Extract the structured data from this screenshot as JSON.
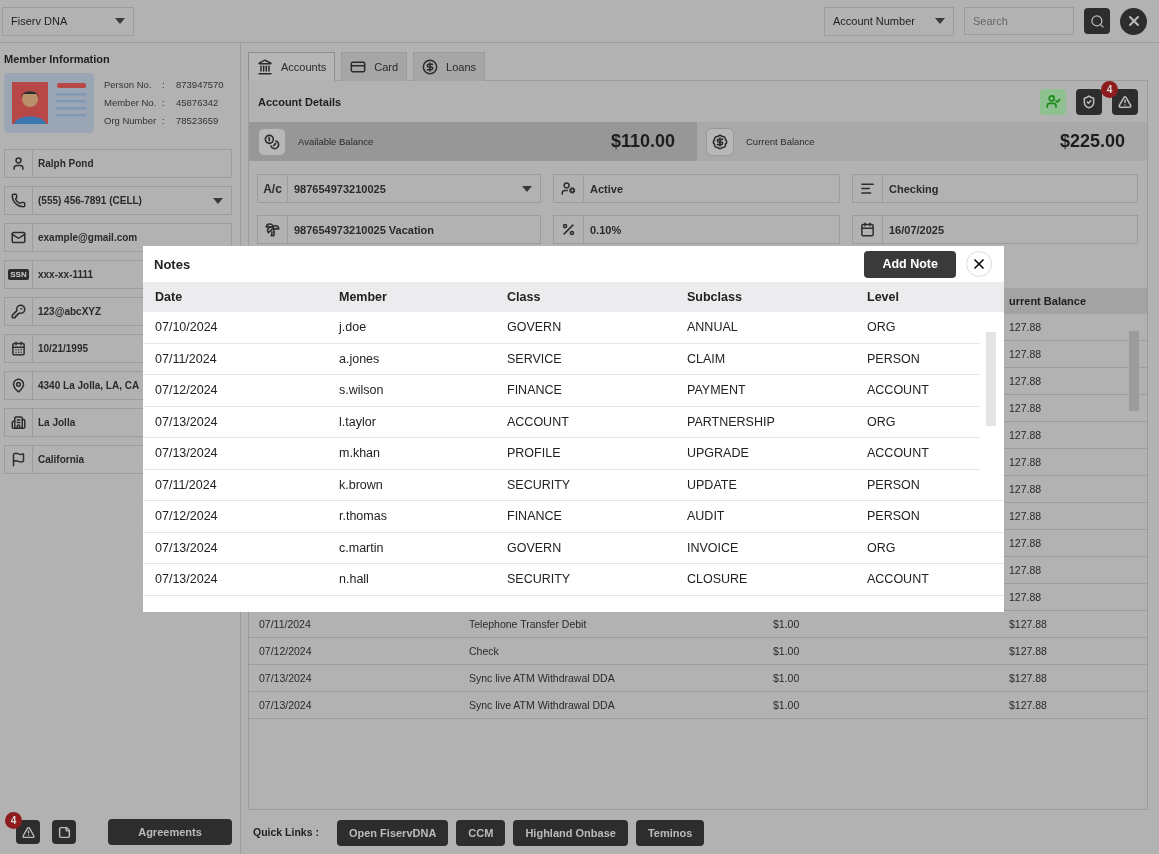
{
  "app_selector": {
    "value": "Fiserv DNA"
  },
  "search_bar": {
    "type_selector": "Account Number",
    "placeholder": "Search"
  },
  "member": {
    "title": "Member Information",
    "ids": [
      {
        "label": "Person No.",
        "sep": ":",
        "value": "873947570"
      },
      {
        "label": "Member No.",
        "sep": ":",
        "value": "45876342"
      },
      {
        "label": "Org Number",
        "sep": ":",
        "value": "78523659"
      }
    ],
    "fields": [
      {
        "value": "Ralph Pond",
        "dropdown": false
      },
      {
        "value": "(555) 456-7891 (CELL)",
        "dropdown": true
      },
      {
        "value": "example@gmail.com",
        "dropdown": false
      },
      {
        "badge": "SSN",
        "value": "xxx-xx-1111"
      },
      {
        "value": "123@abcXYZ"
      },
      {
        "value": "10/21/1995"
      },
      {
        "value": "4340 La Jolla, LA, CA"
      },
      {
        "value": "La Jolla"
      },
      {
        "value": "California"
      }
    ],
    "alerts_badge": "4",
    "agreements_button": "Agreements"
  },
  "tabs": [
    {
      "label": "Accounts",
      "selected": true
    },
    {
      "label": "Card",
      "selected": false
    },
    {
      "label": "Loans",
      "selected": false
    }
  ],
  "account_details": {
    "title": "Account Details",
    "alerts_badge": "4",
    "balances": [
      {
        "label": "Available Balance",
        "amount": "$110.00",
        "highlighted": true
      },
      {
        "label": "Current Balance",
        "amount": "$225.00",
        "highlighted": false
      }
    ],
    "fields": [
      {
        "badge": "A/c",
        "value": "987654973210025",
        "dropdown": true
      },
      {
        "value": "Active",
        "dropdown": false
      },
      {
        "value": "Checking",
        "dropdown": false
      },
      {
        "value": "987654973210025 Vacation",
        "dropdown": false
      },
      {
        "value": "0.10%",
        "dropdown": false
      },
      {
        "value": "16/07/2025",
        "dropdown": false
      }
    ],
    "transactions": {
      "column_4": "urrent Balance",
      "rows": [
        {
          "balance": "127.88"
        },
        {
          "balance": "127.88"
        },
        {
          "balance": "127.88"
        },
        {
          "balance": "127.88"
        },
        {
          "balance": "127.88"
        },
        {
          "balance": "127.88"
        },
        {
          "balance": "127.88"
        },
        {
          "balance": "127.88"
        },
        {
          "balance": "127.88"
        },
        {
          "balance": "127.88"
        },
        {
          "balance": "127.88"
        },
        {
          "date": "07/11/2024",
          "description": "Telephone Transfer Debit",
          "amount": "$1.00",
          "balance": "$127.88"
        },
        {
          "date": "07/12/2024",
          "description": "Check",
          "amount": "$1.00",
          "balance": "$127.88"
        },
        {
          "date": "07/13/2024",
          "description": "Sync live ATM Withdrawal DDA",
          "amount": "$1.00",
          "balance": "$127.88"
        },
        {
          "date": "07/13/2024",
          "description": "Sync live ATM Withdrawal DDA",
          "amount": "$1.00",
          "balance": "$127.88"
        }
      ]
    }
  },
  "quick_links": {
    "label": "Quick Links :",
    "links": [
      "Open FiservDNA",
      "CCM",
      "Highland Onbase",
      "Teminos"
    ]
  },
  "notes_dialog": {
    "title": "Notes",
    "add_button": "Add Note",
    "columns": [
      "Date",
      "Member",
      "Class",
      "Subclass",
      "Level"
    ],
    "rows": [
      [
        "07/10/2024",
        "j.doe",
        "GOVERN",
        "ANNUAL",
        "ORG"
      ],
      [
        "07/11/2024",
        "a.jones",
        "SERVICE",
        "CLAIM",
        "PERSON"
      ],
      [
        "07/12/2024",
        "s.wilson",
        "FINANCE",
        "PAYMENT",
        "ACCOUNT"
      ],
      [
        "07/13/2024",
        "l.taylor",
        "ACCOUNT",
        "PARTNERSHIP",
        "ORG"
      ],
      [
        "07/13/2024",
        "m.khan",
        "PROFILE",
        "UPGRADE",
        "ACCOUNT"
      ],
      [
        "07/11/2024",
        "k.brown",
        "SECURITY",
        "UPDATE",
        "PERSON"
      ],
      [
        "07/12/2024",
        "r.thomas",
        "FINANCE",
        "AUDIT",
        "PERSON"
      ],
      [
        "07/13/2024",
        "c.martin",
        "GOVERN",
        "INVOICE",
        "ORG"
      ],
      [
        "07/13/2024",
        "n.hall",
        "SECURITY",
        "CLOSURE",
        "ACCOUNT"
      ]
    ]
  }
}
